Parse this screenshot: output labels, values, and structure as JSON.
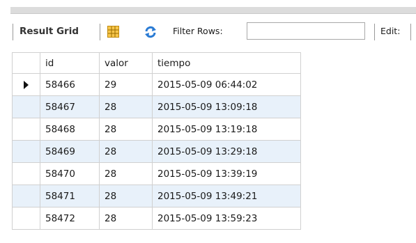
{
  "toolbar": {
    "result_grid_label": "Result Grid",
    "grid_icon": "form-grid-icon",
    "refresh_icon": "refresh-icon",
    "filter_label": "Filter Rows:",
    "filter_value": "",
    "edit_label": "Edit:"
  },
  "table": {
    "columns": [
      "id",
      "valor",
      "tiempo"
    ],
    "rows": [
      [
        "58466",
        "29",
        "2015-05-09 06:44:02"
      ],
      [
        "58467",
        "28",
        "2015-05-09 13:09:18"
      ],
      [
        "58468",
        "28",
        "2015-05-09 13:19:18"
      ],
      [
        "58469",
        "28",
        "2015-05-09 13:29:18"
      ],
      [
        "58470",
        "28",
        "2015-05-09 13:39:19"
      ],
      [
        "58471",
        "28",
        "2015-05-09 13:49:21"
      ],
      [
        "58472",
        "28",
        "2015-05-09 13:59:23"
      ]
    ],
    "selected_row": 0
  },
  "colors": {
    "alt_row": "#e8f1fa",
    "grid_line": "#d0d0d0",
    "refresh_blue": "#2a7bd4"
  }
}
